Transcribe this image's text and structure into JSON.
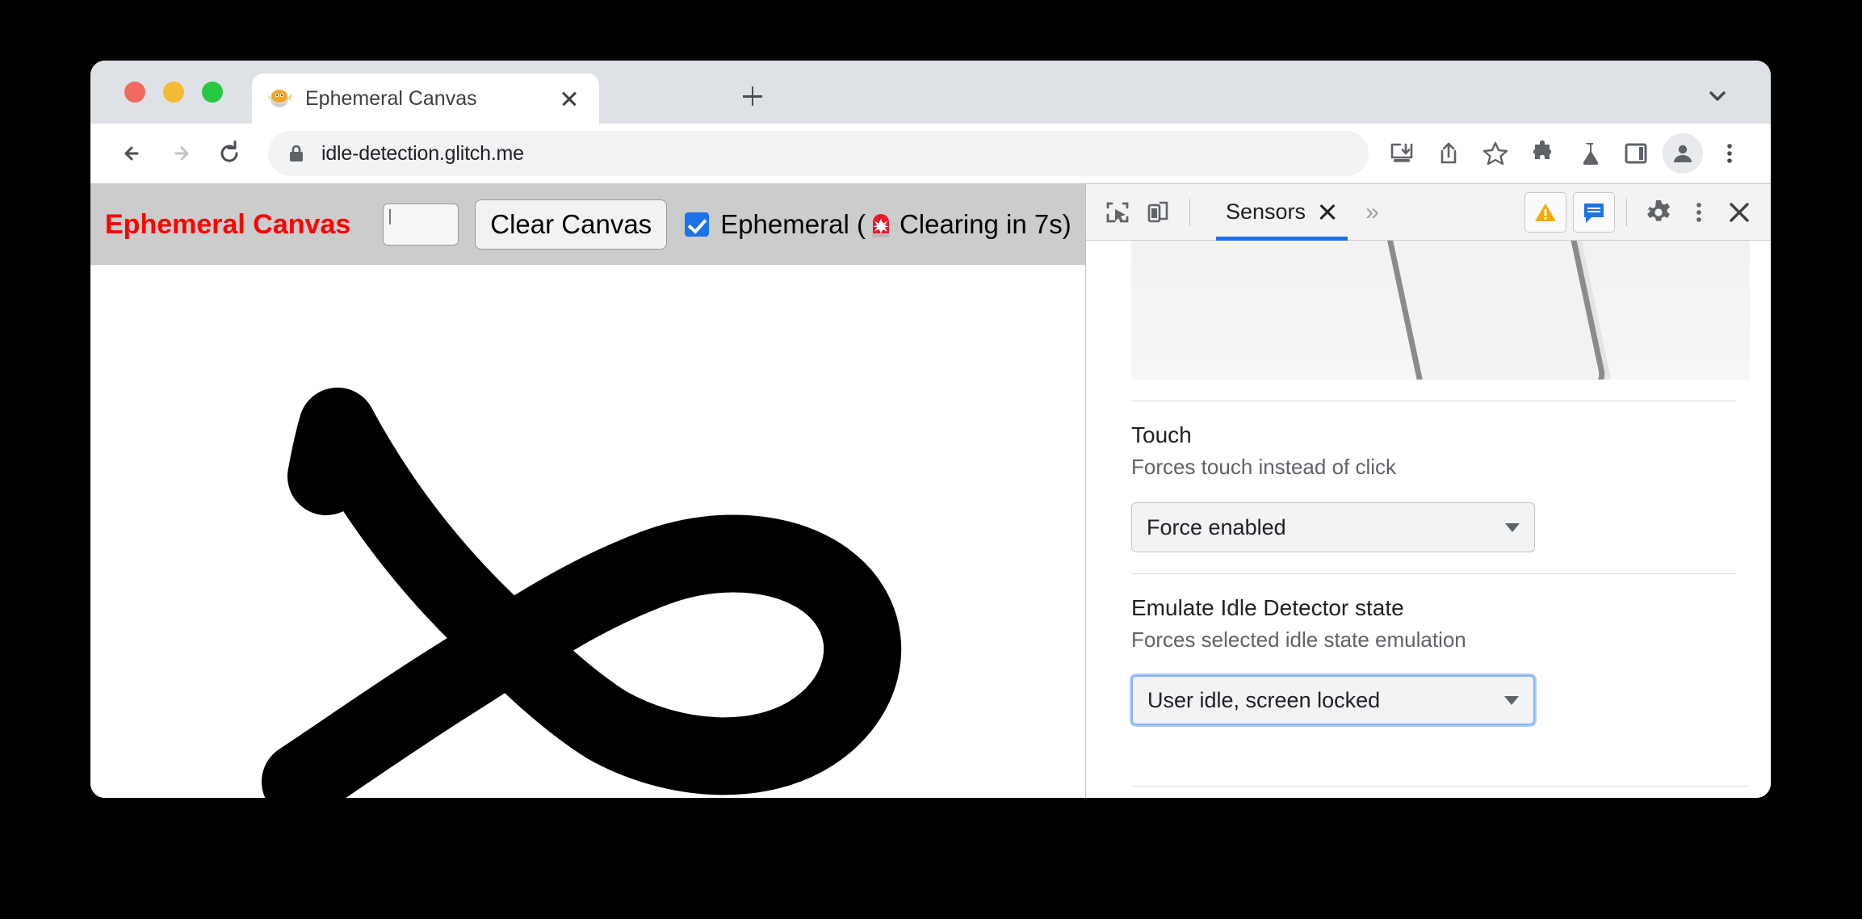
{
  "window": {
    "traffic_lights": [
      "close",
      "minimize",
      "maximize"
    ],
    "colors": {
      "red": "#f2695f",
      "yellow": "#f3ba35",
      "green": "#28c840",
      "accent": "#1a73e8"
    }
  },
  "tabstrip": {
    "tab": {
      "title": "Ephemeral Canvas",
      "favicon": "blowfish-favicon",
      "close_label": "x"
    },
    "new_tab_label": "+",
    "tab_search_label": "chevron-down-icon"
  },
  "omnibar": {
    "back_label": "back-arrow",
    "forward_label": "forward-arrow",
    "reload_label": "reload",
    "lock_label": "lock-icon",
    "url": "idle-detection.glitch.me",
    "actions": [
      "install-icon",
      "share-icon",
      "bookmark-star-icon",
      "extensions-puzzle-icon",
      "flask-icon",
      "side-panel-icon",
      "profile-avatar",
      "browser-menu-icon"
    ]
  },
  "page": {
    "title": "Ephemeral Canvas",
    "color_value": "#000000",
    "clear_button": "Clear Canvas",
    "ephemeral_checked": true,
    "ephemeral_label_before": "Ephemeral (",
    "siren_icon": "rotating-light-emoji",
    "ephemeral_label_after": " Clearing in 7s)",
    "canvas_drawing": "black-freehand-fish-shape"
  },
  "devtools": {
    "toolbar": {
      "inspect_label": "inspect-element-icon",
      "device_toggle_label": "device-toolbar-icon",
      "tab_label": "Sensors",
      "tab_close_label": "x",
      "more_tabs_label": "»",
      "warnings_label": "warning-triangle-icon",
      "console_label": "console-message-icon",
      "settings_label": "gear-icon",
      "menu_label": "three-dot-icon",
      "close_label": "close-icon"
    },
    "orientation": {
      "preview_label": "device-orientation-3d-preview"
    },
    "sections": [
      {
        "title": "Touch",
        "subtitle": "Forces touch instead of click",
        "select_value": "Force enabled",
        "focused": false
      },
      {
        "title": "Emulate Idle Detector state",
        "subtitle": "Forces selected idle state emulation",
        "select_value": "User idle, screen locked",
        "focused": true
      }
    ]
  }
}
